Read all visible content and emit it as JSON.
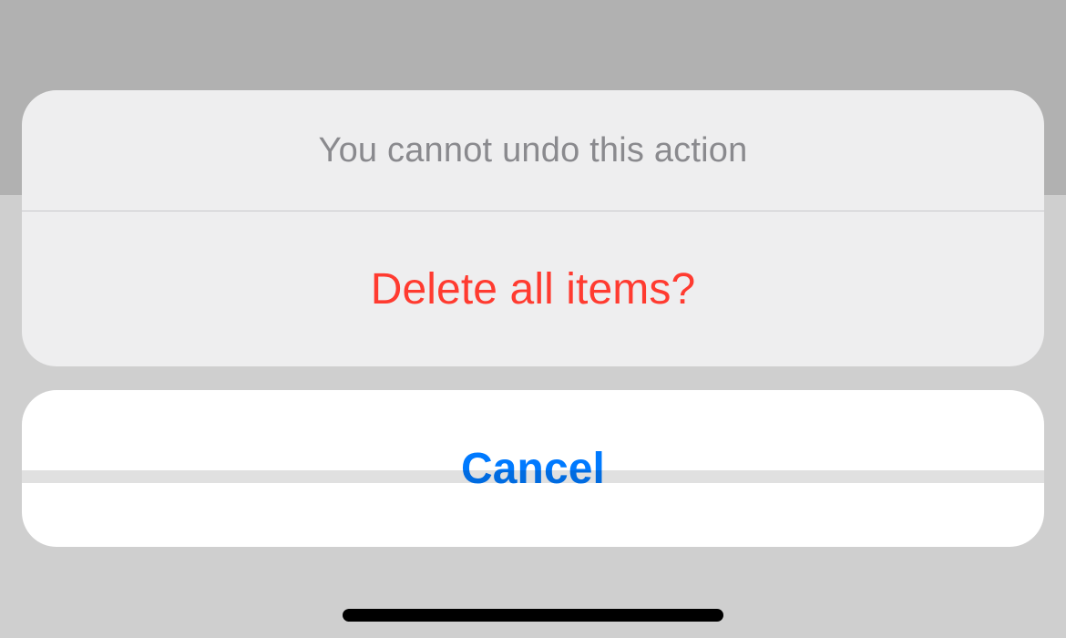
{
  "actionSheet": {
    "header": "You cannot undo this action",
    "destructiveAction": "Delete all items?",
    "cancel": "Cancel"
  },
  "colors": {
    "destructive": "#ff3b30",
    "primary": "#007aff",
    "secondaryText": "#8a8a8e",
    "sheetBackground": "#eeeeef",
    "cancelBackground": "#ffffff"
  }
}
